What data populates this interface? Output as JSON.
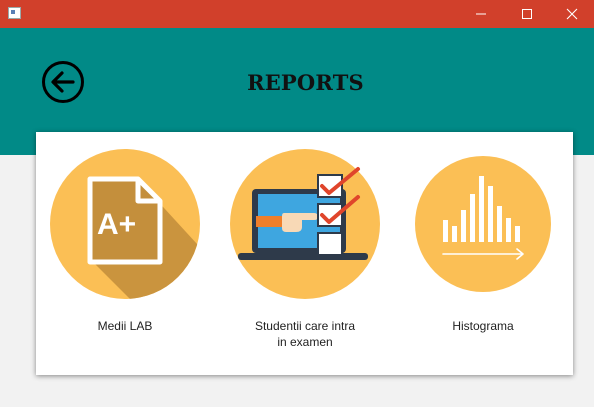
{
  "window": {
    "minimize": "—",
    "maximize": "☐",
    "close": "✕"
  },
  "header": {
    "title": "REPORTS",
    "back_icon": "arrow-left-circle-icon",
    "color": "#018a87"
  },
  "titlebar_color": "#d1402b",
  "reports": [
    {
      "label": "Medii LAB",
      "icon": "document-grade-icon"
    },
    {
      "label_line1": "Studentii care intra",
      "label_line2": "in examen",
      "icon": "laptop-checklist-icon"
    },
    {
      "label": "Histograma",
      "icon": "histogram-icon"
    }
  ]
}
